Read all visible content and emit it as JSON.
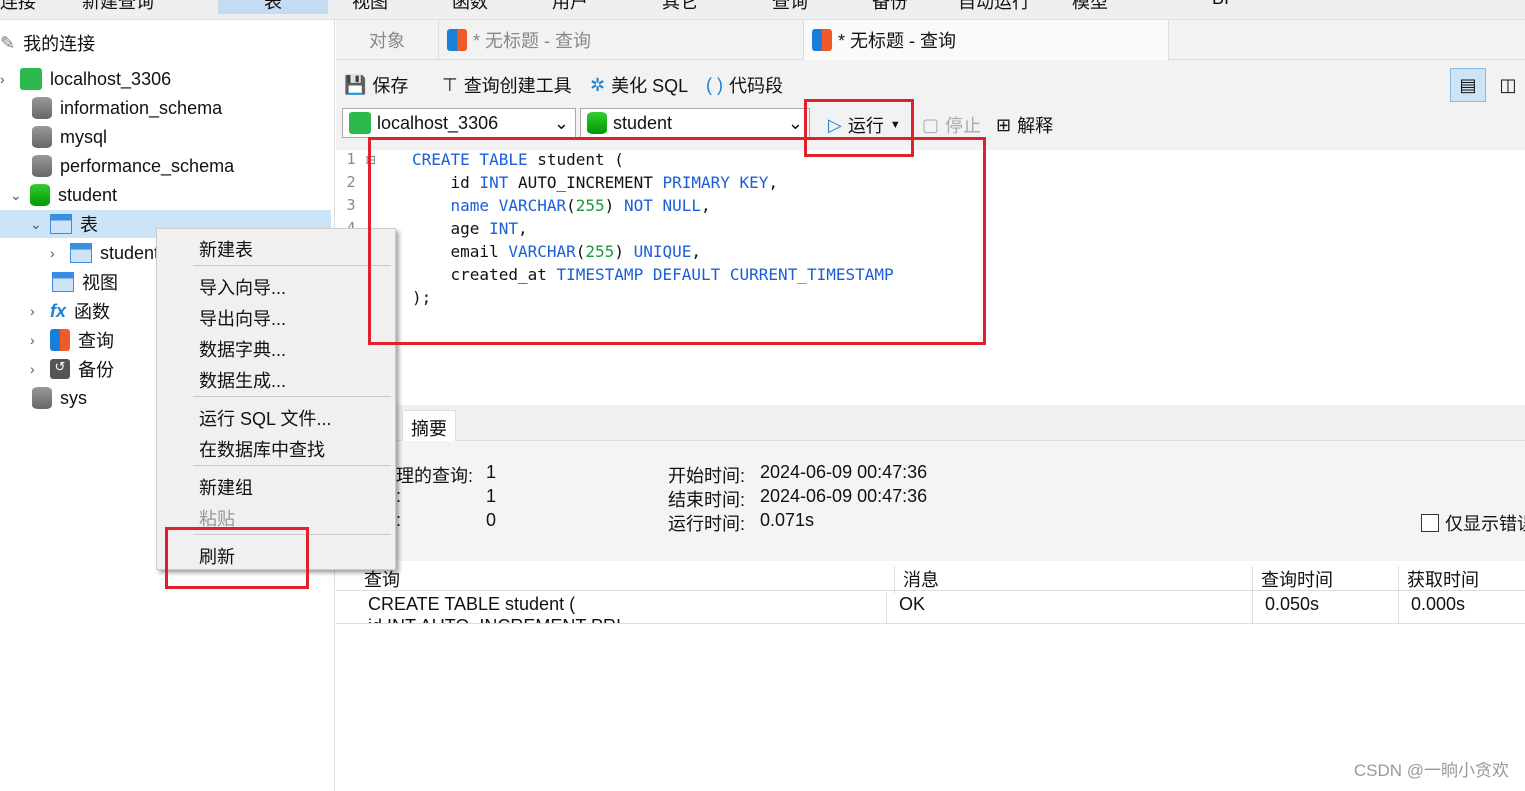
{
  "menu": [
    "连接",
    "新建查询",
    "表",
    "视图",
    "函数",
    "用户",
    "其它",
    "查询",
    "备份",
    "自动运行",
    "模型",
    "BI"
  ],
  "sidebar": {
    "root": "我的连接",
    "connection": "localhost_3306",
    "databases": [
      "information_schema",
      "mysql",
      "performance_schema",
      "student",
      "sys"
    ],
    "student_children": {
      "tables": "表",
      "table_item": "student",
      "views": "视图",
      "functions": "函数",
      "queries": "查询",
      "backups": "备份"
    }
  },
  "tabs": [
    {
      "label": "对象"
    },
    {
      "label": "* 无标题 - 查询"
    },
    {
      "label": "* 无标题 - 查询"
    }
  ],
  "toolbar": {
    "save": "保存",
    "query_builder": "查询创建工具",
    "beautify": "美化 SQL",
    "snippet": "代码段",
    "connection": "localhost_3306",
    "database": "student",
    "run": "运行",
    "stop": "停止",
    "explain": "解释"
  },
  "editor": {
    "lines": [
      [
        {
          "t": "CREATE TABLE",
          "c": "kw"
        },
        {
          "t": " student ("
        }
      ],
      [
        {
          "t": "    id "
        },
        {
          "t": "INT",
          "c": "kw"
        },
        {
          "t": " AUTO_INCREMENT "
        },
        {
          "t": "PRIMARY KEY",
          "c": "kw"
        },
        {
          "t": ","
        }
      ],
      [
        {
          "t": "    "
        },
        {
          "t": "name VARCHAR",
          "c": "kw"
        },
        {
          "t": "("
        },
        {
          "t": "255",
          "c": "num"
        },
        {
          "t": ") "
        },
        {
          "t": "NOT NULL",
          "c": "kw"
        },
        {
          "t": ","
        }
      ],
      [
        {
          "t": "    age "
        },
        {
          "t": "INT",
          "c": "kw"
        },
        {
          "t": ","
        }
      ],
      [
        {
          "t": "    email "
        },
        {
          "t": "VARCHAR",
          "c": "kw"
        },
        {
          "t": "("
        },
        {
          "t": "255",
          "c": "num"
        },
        {
          "t": ") "
        },
        {
          "t": "UNIQUE",
          "c": "kw"
        },
        {
          "t": ","
        }
      ],
      [
        {
          "t": "    created_at "
        },
        {
          "t": "TIMESTAMP DEFAULT CURRENT_TIMESTAMP",
          "c": "kw"
        }
      ],
      [
        {
          "t": ");"
        }
      ]
    ]
  },
  "result": {
    "tab": "摘要",
    "processed_label": "理的查询:",
    "processed": "1",
    "l2": ":",
    "v2": "1",
    "l3": ":",
    "v3": "0",
    "start_label": "开始时间:",
    "start": "2024-06-09 00:47:36",
    "end_label": "结束时间:",
    "end": "2024-06-09 00:47:36",
    "elapsed_label": "运行时间:",
    "elapsed": "0.071s",
    "errors_only": "仅显示错误",
    "columns": [
      "查询",
      "消息",
      "查询时间",
      "获取时间"
    ],
    "row": [
      "CREATE TABLE student (",
      "OK",
      "0.050s",
      "0.000s"
    ],
    "row_cut": "    id INT AUTO_INCREMENT PRI"
  },
  "context_menu": [
    "新建表",
    "导入向导...",
    "导出向导...",
    "数据字典...",
    "数据生成...",
    "运行 SQL 文件...",
    "在数据库中查找",
    "新建组",
    "粘贴",
    "刷新"
  ],
  "watermark": "CSDN @一晌小贪欢",
  "colors": {
    "highlight": "#e0202a",
    "keyword": "#1a5fd8",
    "number": "#1a9a3a"
  }
}
